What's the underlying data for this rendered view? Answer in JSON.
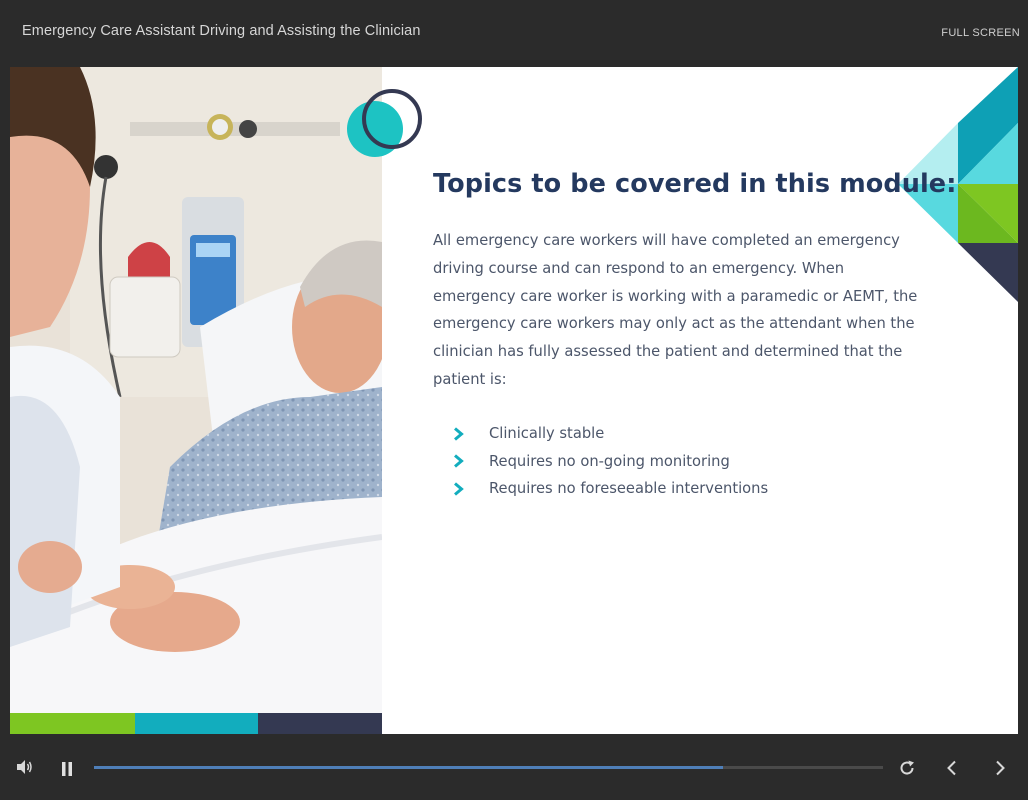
{
  "header": {
    "title": "Emergency Care Assistant Driving and Assisting the Clinician",
    "fullscreen_label": "FULL SCREEN"
  },
  "slide": {
    "heading": "Topics to be covered in this module:",
    "body": "All emergency care workers will have completed an emergency driving course and can respond to an emergency. When emergency care worker is working with a paramedic or AEMT, the emergency care workers may only act as the attendant when the clinician has fully assessed the patient and determined that the patient is:",
    "bullets": [
      "Clinically stable",
      "Requires no on-going monitoring",
      "Requires no foreseeable interventions"
    ]
  },
  "player": {
    "progress_fraction": 0.797
  },
  "icons": {
    "volume": "volume-icon",
    "pause": "pause-icon",
    "replay": "replay-icon",
    "previous": "chevron-left-icon",
    "next": "chevron-right-icon",
    "bullet": "chevron-right-icon"
  },
  "colors": {
    "teal": "#12adbe",
    "dark_teal": "#0ea0b5",
    "light_teal": "#58d9df",
    "pale_teal": "#b4eef0",
    "green": "#7ec622",
    "navy": "#343952",
    "heading": "#24395f",
    "accent_circle": "#1dc3c3"
  }
}
